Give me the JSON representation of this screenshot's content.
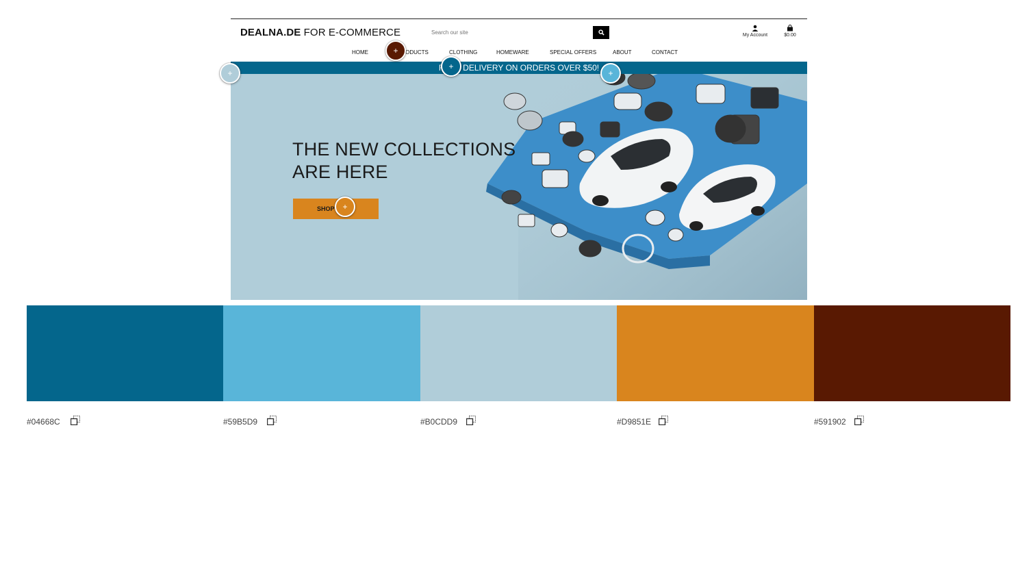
{
  "site": {
    "logo_bold": "DEALNA.DE",
    "logo_rest": " FOR E-COMMERCE",
    "search_placeholder": "Search our site",
    "account_label": "My Account",
    "cart_label": "$0.00",
    "nav": [
      "HOME",
      "PRODUCTS",
      "CLOTHING",
      "HOMEWARE",
      "SPECIAL OFFERS",
      "ABOUT",
      "CONTACT"
    ],
    "banner": "FREE DELIVERY ON ORDERS OVER $50!",
    "hero_title_line1": "THE NEW COLLECTIONS",
    "hero_title_line2": "ARE HERE",
    "shop_button": "SHOP NOW"
  },
  "palette": [
    {
      "hex": "#04668C",
      "label": "#04668C"
    },
    {
      "hex": "#59B5D9",
      "label": "#59B5D9"
    },
    {
      "hex": "#B0CDD9",
      "label": "#B0CDD9"
    },
    {
      "hex": "#D9851E",
      "label": "#D9851E"
    },
    {
      "hex": "#591902",
      "label": "#591902"
    }
  ],
  "pins": [
    {
      "target": "products-nav",
      "color": "#591902"
    },
    {
      "target": "banner",
      "color": "#04668C"
    },
    {
      "target": "banner-end",
      "color": "#59B5D9"
    },
    {
      "target": "hero-background",
      "color": "#B0CDD9"
    },
    {
      "target": "shop-button",
      "color": "#D9851E"
    }
  ],
  "icons": {
    "search": "search-icon",
    "account": "user-icon",
    "cart": "shopping-bag-icon",
    "copy": "copy-icon",
    "pin": "plus-icon"
  }
}
